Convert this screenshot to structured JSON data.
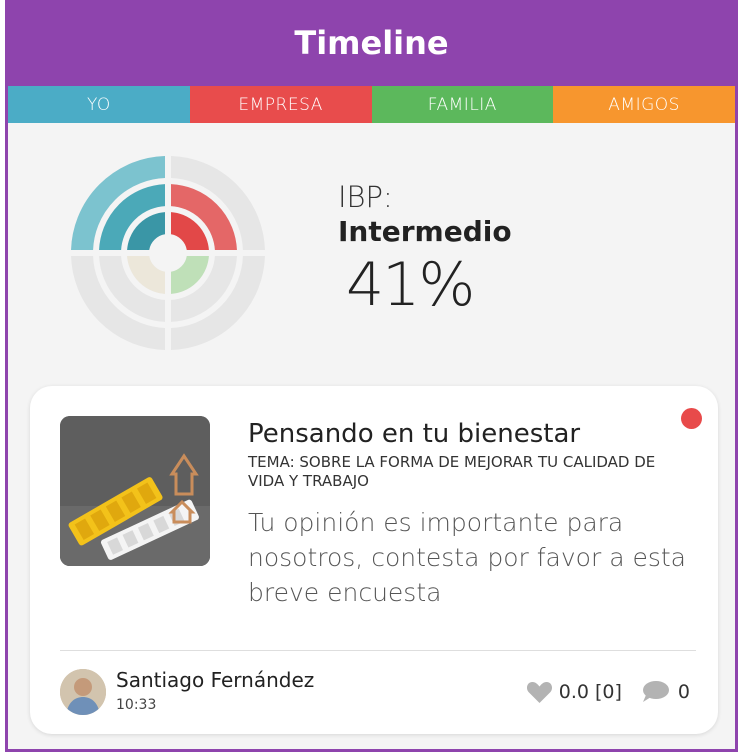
{
  "header": {
    "title": "Timeline",
    "background": "#8e44ad"
  },
  "tabs": [
    {
      "label": "YO",
      "color": "#4bacc6"
    },
    {
      "label": "EMPRESA",
      "color": "#e84c4c"
    },
    {
      "label": "FAMILIA",
      "color": "#5cb85c"
    },
    {
      "label": "AMIGOS",
      "color": "#f7962e"
    }
  ],
  "ibp": {
    "label": "IBP:",
    "level": "Intermedio",
    "percent": "41%"
  },
  "post": {
    "title": "Pensando en tu bienestar",
    "topic": "TEMA: SOBRE LA FORMA DE MEJORAR TU CALIDAD DE VIDA Y TRABAJO",
    "body": "Tu opinión es importante para nosotros, contesta por favor a esta breve encuesta",
    "thumbnail_icon": "happy-welcome-image",
    "unread_color": "#e84a4a",
    "author": "Santiago Fernández",
    "time": "10:33",
    "likes": "0.0 [0]",
    "comments": "0"
  }
}
